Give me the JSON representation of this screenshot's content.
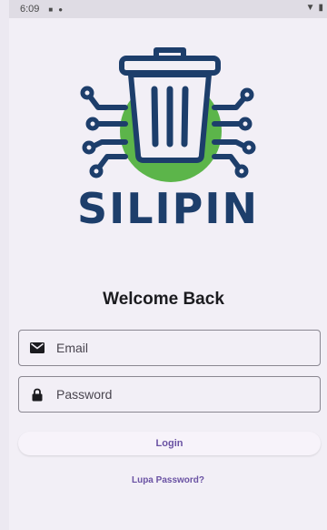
{
  "status_bar": {
    "time": "6:09",
    "icons": [
      "notification-square-icon",
      "shield-icon"
    ],
    "right_icons": [
      "wifi-icon",
      "battery-icon"
    ]
  },
  "app": {
    "name": "SILIPIN",
    "logo_icon": "trash-bin-circuit-icon",
    "colors": {
      "brand": "#1d3e6b",
      "logo_circle": "#5cb54a",
      "accent": "#6a52a3"
    }
  },
  "login_form": {
    "heading": "Welcome Back",
    "email": {
      "icon": "mail-icon",
      "placeholder": "Email",
      "value": ""
    },
    "password": {
      "icon": "lock-icon",
      "placeholder": "Password",
      "value": ""
    },
    "login_label": "Login",
    "forgot_label": "Lupa Password?"
  }
}
